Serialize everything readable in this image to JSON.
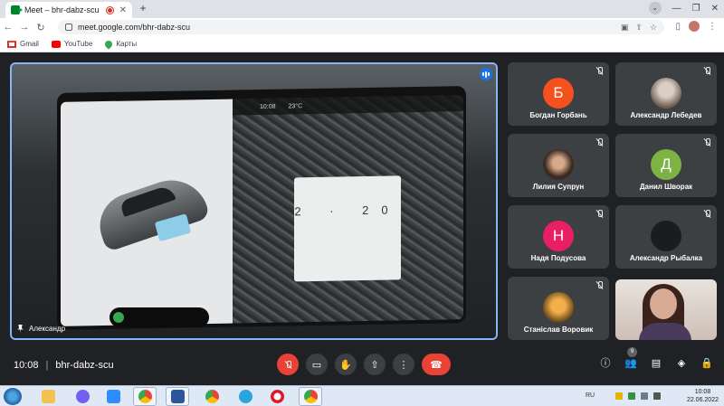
{
  "browser": {
    "tab_title": "Meet – bhr-dabz-scu",
    "tab_close": "✕",
    "new_tab": "+",
    "url": "meet.google.com/bhr-dabz-scu",
    "bookmarks": [
      {
        "label": "Gmail",
        "icon": "gmail-icon"
      },
      {
        "label": "YouTube",
        "icon": "youtube-icon"
      },
      {
        "label": "Карты",
        "icon": "maps-icon"
      }
    ]
  },
  "meeting": {
    "time": "10:08",
    "code": "bhr-dabz-scu",
    "separator": "|",
    "participants_count": "9",
    "main_speaker": "Александр",
    "shared_screen": {
      "top_time": "10:08",
      "temperature": "23°C",
      "timer_value": "2 · 20"
    }
  },
  "participants": [
    {
      "name": "Богдан Горбань",
      "initial": "Б",
      "color": "#f4511e",
      "kind": "initial"
    },
    {
      "name": "Александр Лебедев",
      "initial": "",
      "color": "#7a6a5a",
      "kind": "photo"
    },
    {
      "name": "Лилия Супрун",
      "initial": "",
      "color": "#5a4a3a",
      "kind": "photo"
    },
    {
      "name": "Данил Шворак",
      "initial": "Д",
      "color": "#7cb342",
      "kind": "initial"
    },
    {
      "name": "Надя Подусова",
      "initial": "Н",
      "color": "#e91e63",
      "kind": "initial"
    },
    {
      "name": "Александр Рыбалка",
      "initial": "",
      "color": "#202124",
      "kind": "initial"
    },
    {
      "name": "Станіслав Воровик",
      "initial": "",
      "color": "#e0a040",
      "kind": "photo"
    }
  ],
  "taskbar": {
    "lang": "RU",
    "clock_time": "10:08",
    "clock_date": "22.06.2022"
  }
}
